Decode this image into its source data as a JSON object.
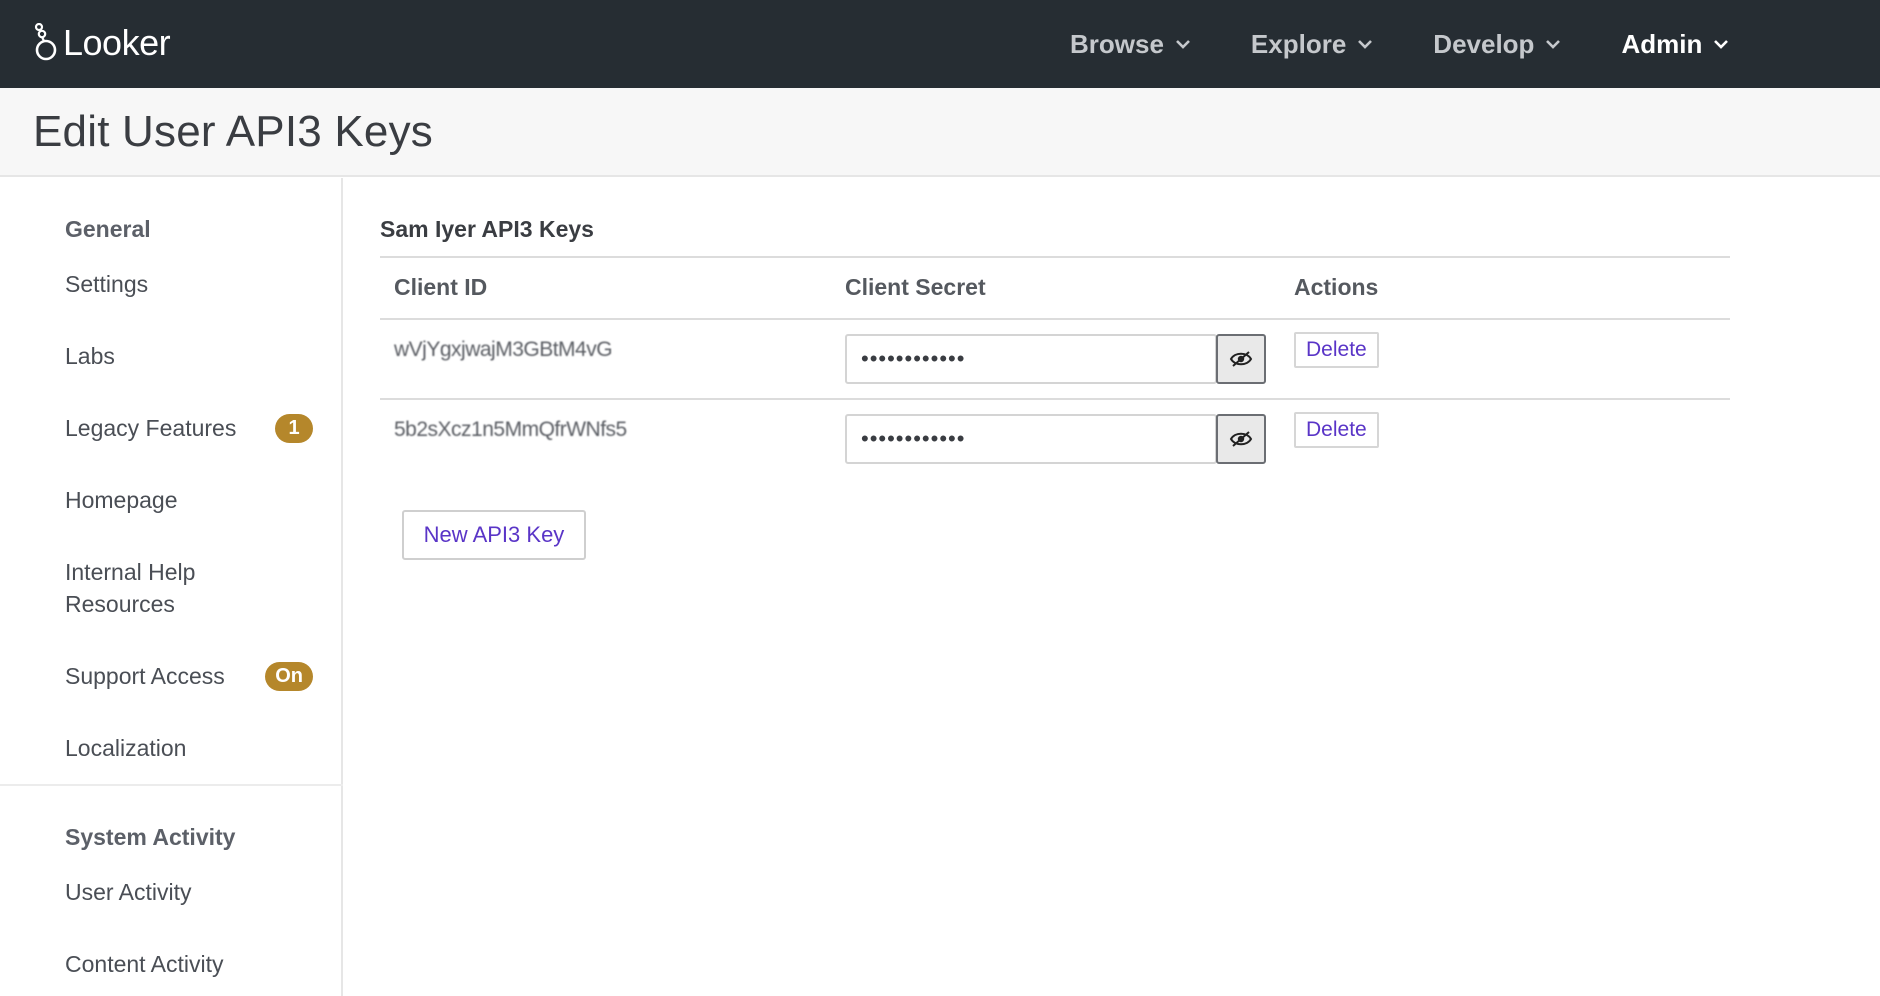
{
  "app": {
    "brand": "Looker",
    "nav": [
      {
        "label": "Browse",
        "active": false
      },
      {
        "label": "Explore",
        "active": false
      },
      {
        "label": "Develop",
        "active": false
      },
      {
        "label": "Admin",
        "active": true
      }
    ]
  },
  "page": {
    "title": "Edit User API3 Keys"
  },
  "sidebar": {
    "sections": [
      {
        "title": "General",
        "items": [
          {
            "label": "Settings"
          },
          {
            "label": "Labs"
          },
          {
            "label": "Legacy Features",
            "badge": "1"
          },
          {
            "label": "Homepage"
          },
          {
            "label": "Internal Help Resources"
          },
          {
            "label": "Support Access",
            "badge": "On"
          },
          {
            "label": "Localization"
          }
        ]
      },
      {
        "title": "System Activity",
        "items": [
          {
            "label": "User Activity"
          },
          {
            "label": "Content Activity"
          }
        ]
      }
    ]
  },
  "main": {
    "section_title": "Sam Iyer API3 Keys",
    "columns": [
      "Client ID",
      "Client Secret",
      "Actions"
    ],
    "keys": [
      {
        "client_id": "wVjYgxjwajM3GBtM4vG",
        "client_secret_masked": "••••••••••••",
        "action_label": "Delete"
      },
      {
        "client_id": "5b2sXcz1n5MmQfrWNfs5",
        "client_secret_masked": "••••••••••••",
        "action_label": "Delete"
      }
    ],
    "new_key_label": "New API3 Key"
  },
  "colors": {
    "topbar": "#262d33",
    "accent_link": "#5a35c7",
    "badge": "#b5872b"
  },
  "icons": {
    "brand": "looker-logo-icon",
    "nav_dropdown": "chevron-down-icon",
    "reveal_secret": "eye-slash-icon"
  }
}
